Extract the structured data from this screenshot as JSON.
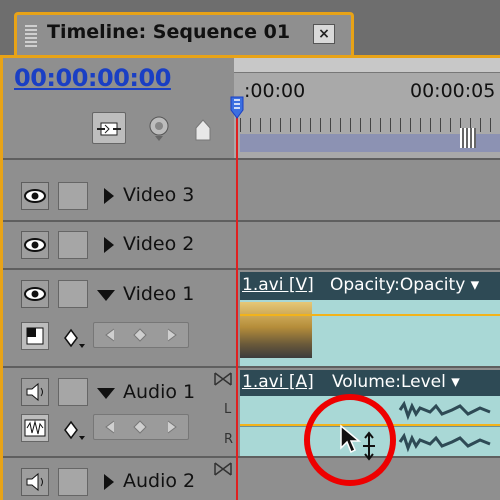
{
  "tab": {
    "title": "Timeline: Sequence 01",
    "close_icon": "×"
  },
  "timecode": "00:00:00:00",
  "tools": [
    "snap-icon",
    "set-marker-icon",
    "keyframe-icon"
  ],
  "ruler": {
    "start": ":00:00",
    "end": "00:00:05"
  },
  "tracks": {
    "video3": {
      "name": "Video 3"
    },
    "video2": {
      "name": "Video 2"
    },
    "video1": {
      "name": "Video 1",
      "clip_label": "1.avi [V]",
      "effect": "Opacity:Opacity ▾"
    },
    "audio1": {
      "name": "Audio 1",
      "clip_label": "1.avi [A]",
      "effect": "Volume:Level ▾",
      "channel_l": "L",
      "channel_r": "R"
    },
    "audio2": {
      "name": "Audio 2"
    }
  },
  "colors": {
    "accent": "#e8a317",
    "playhead": "#e02020",
    "timecode": "#1a3fc4",
    "clip_body": "#a9d8d6",
    "clip_header": "#2e4a55"
  }
}
